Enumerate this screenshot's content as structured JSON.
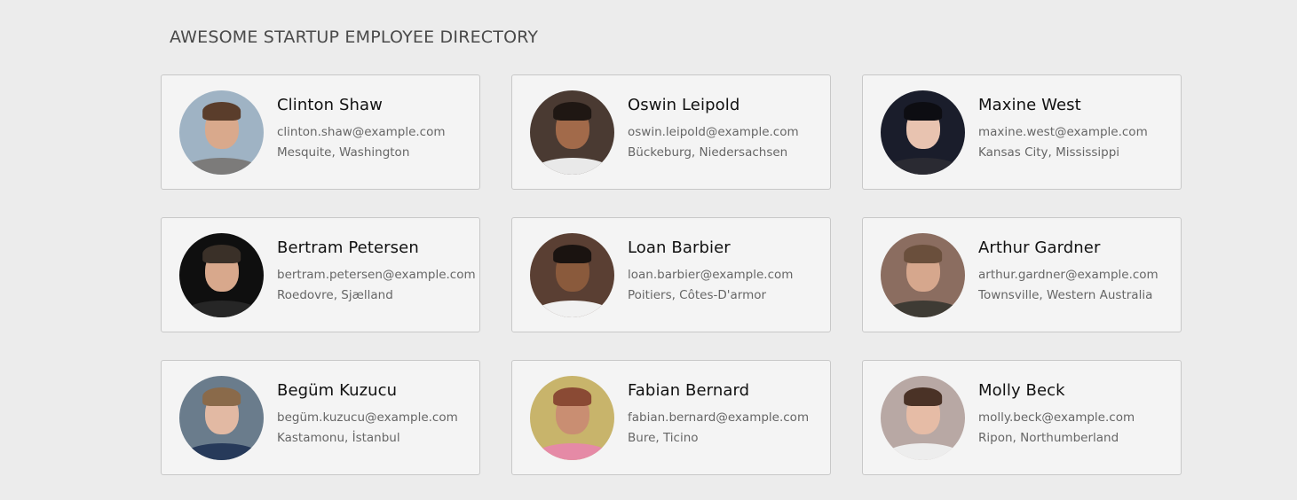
{
  "header": {
    "title": "AWESOME STARTUP EMPLOYEE DIRECTORY"
  },
  "employees": [
    {
      "name": "Clinton Shaw",
      "email": "clinton.shaw@example.com",
      "location": "Mesquite, Washington",
      "avatar": {
        "bg": "#9fb3c4",
        "skin": "#d9a98c",
        "hair": "#5a3d2b",
        "shirt": "#7c7b7a"
      }
    },
    {
      "name": "Oswin Leipold",
      "email": "oswin.leipold@example.com",
      "location": "Bückeburg, Niedersachsen",
      "avatar": {
        "bg": "#4a3a32",
        "skin": "#a26a4a",
        "hair": "#1f1713",
        "shirt": "#e9e9e9"
      }
    },
    {
      "name": "Maxine West",
      "email": "maxine.west@example.com",
      "location": "Kansas City, Mississippi",
      "avatar": {
        "bg": "#1a1d2b",
        "skin": "#e8c3b0",
        "hair": "#0d0d12",
        "shirt": "#2a2a32"
      }
    },
    {
      "name": "Bertram Petersen",
      "email": "bertram.petersen@example.com",
      "location": "Roedovre, Sjælland",
      "avatar": {
        "bg": "#0f0f0f",
        "skin": "#d8a88c",
        "hair": "#3a3028",
        "shirt": "#262626"
      }
    },
    {
      "name": "Loan Barbier",
      "email": "loan.barbier@example.com",
      "location": "Poitiers, Côtes-D'armor",
      "avatar": {
        "bg": "#5a3f33",
        "skin": "#8a5a3c",
        "hair": "#1a1310",
        "shirt": "#f1f1f1"
      }
    },
    {
      "name": "Arthur Gardner",
      "email": "arthur.gardner@example.com",
      "location": "Townsville, Western Australia",
      "avatar": {
        "bg": "#8b6d60",
        "skin": "#d6a78d",
        "hair": "#6a4f3c",
        "shirt": "#3e3b34"
      }
    },
    {
      "name": "Begüm Kuzucu",
      "email": "begüm.kuzucu@example.com",
      "location": "Kastamonu, İstanbul",
      "avatar": {
        "bg": "#6a7c8c",
        "skin": "#e2b9a3",
        "hair": "#8a6a4a",
        "shirt": "#273a5a"
      }
    },
    {
      "name": "Fabian Bernard",
      "email": "fabian.bernard@example.com",
      "location": "Bure, Ticino",
      "avatar": {
        "bg": "#c8b46b",
        "skin": "#c98e72",
        "hair": "#8a4a34",
        "shirt": "#e58aa6"
      }
    },
    {
      "name": "Molly Beck",
      "email": "molly.beck@example.com",
      "location": "Ripon, Northumberland",
      "avatar": {
        "bg": "#b8a8a4",
        "skin": "#e6bca6",
        "hair": "#4a3226",
        "shirt": "#ededed"
      }
    }
  ]
}
